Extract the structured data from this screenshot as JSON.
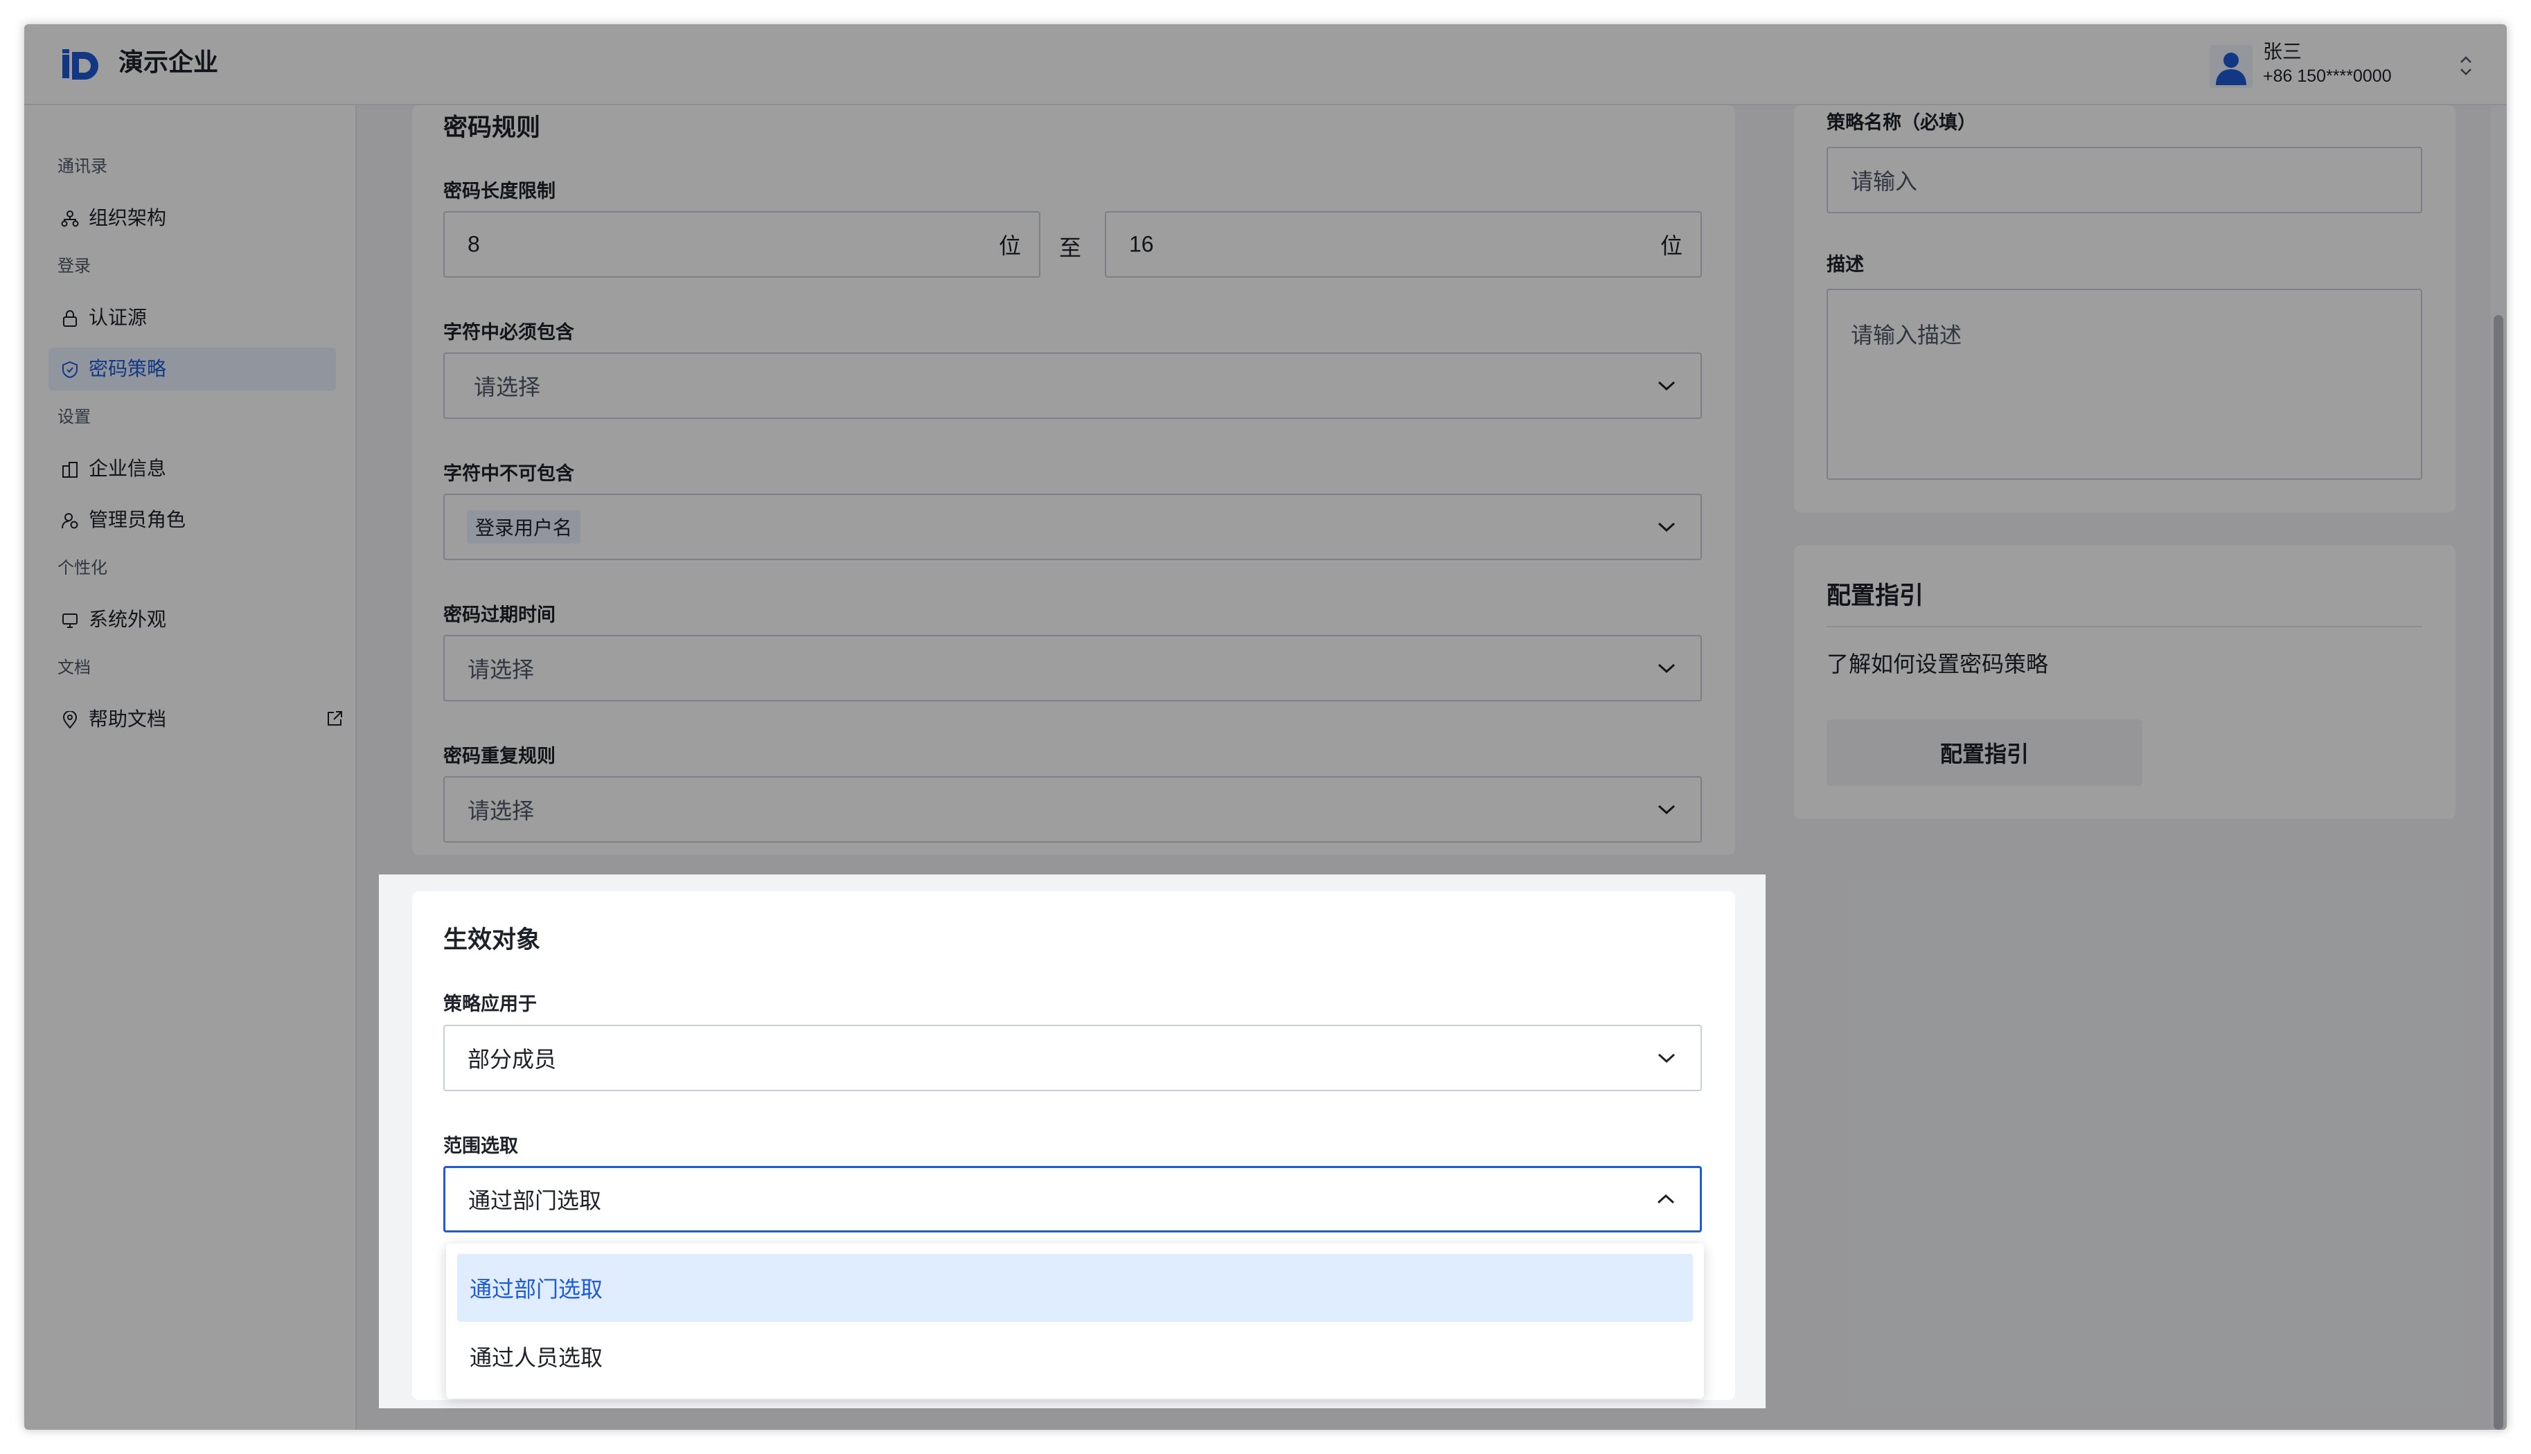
{
  "app": {
    "brand": "演示企业"
  },
  "user": {
    "name": "张三",
    "phone": "+86 150****0000"
  },
  "sidebar": {
    "sections": {
      "contacts": "通讯录",
      "login": "登录",
      "settings": "设置",
      "personalize": "个性化",
      "docs": "文档"
    },
    "items": [
      {
        "label": "组织架构",
        "icon": "org-chart-icon"
      },
      {
        "label": "认证源",
        "icon": "lock-icon"
      },
      {
        "label": "密码策略",
        "icon": "shield-icon",
        "active": true
      },
      {
        "label": "企业信息",
        "icon": "building-icon"
      },
      {
        "label": "管理员角色",
        "icon": "admin-role-icon"
      },
      {
        "label": "系统外观",
        "icon": "monitor-icon"
      },
      {
        "label": "帮助文档",
        "icon": "location-pin-icon",
        "external": true
      }
    ]
  },
  "rules": {
    "title": "密码规则",
    "length": {
      "label": "密码长度限制",
      "min": "8",
      "max": "16",
      "unit": "位",
      "to": "至"
    },
    "must_include": {
      "label": "字符中必须包含",
      "placeholder": "请选择"
    },
    "must_exclude": {
      "label": "字符中不可包含",
      "tag": "登录用户名"
    },
    "expire": {
      "label": "密码过期时间",
      "placeholder": "请选择"
    },
    "repeat": {
      "label": "密码重复规则",
      "placeholder": "请选择"
    }
  },
  "right_panel": {
    "name_label": "策略名称（必填）",
    "name_placeholder": "请输入",
    "desc_label": "描述",
    "desc_placeholder": "请输入描述",
    "guide": {
      "title": "配置指引",
      "text": "了解如何设置密码策略",
      "button": "配置指引"
    }
  },
  "target": {
    "title": "生效对象",
    "apply_label": "策略应用于",
    "apply_value": "部分成员",
    "scope_label": "范围选取",
    "scope_value": "通过部门选取",
    "options": [
      "通过部门选取",
      "通过人员选取"
    ],
    "selected_index": 0
  },
  "colors": {
    "accent": "#1e5bd4",
    "selected_bg": "#e0ecff",
    "overlay": "rgba(0,0,0,0.38)"
  }
}
